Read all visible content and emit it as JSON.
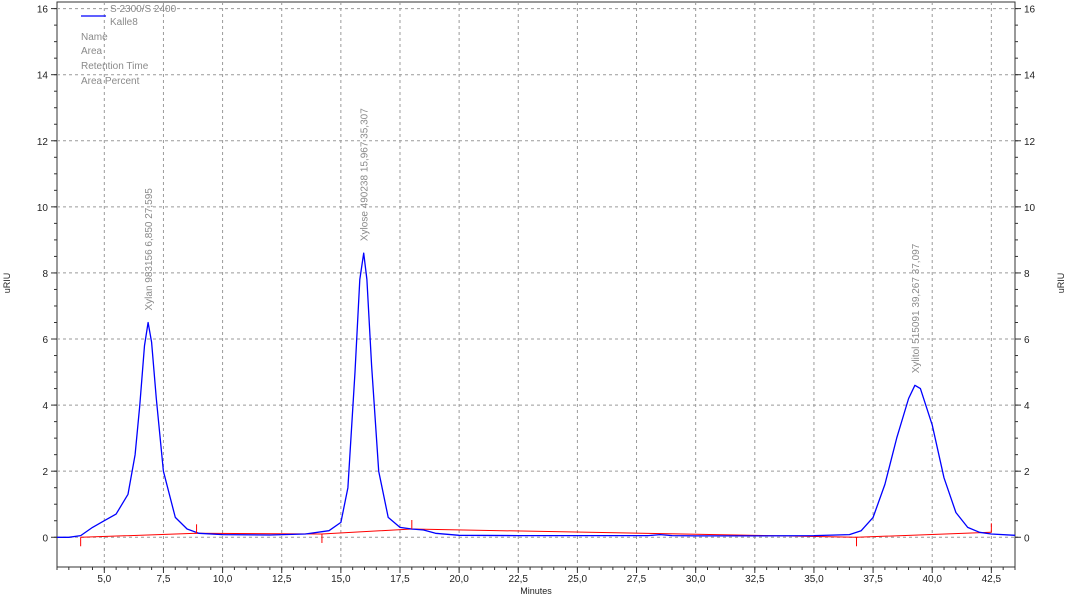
{
  "chart_data": {
    "type": "line",
    "xlabel": "Minutes",
    "ylabel_left": "uRIU",
    "ylabel_right": "uRIU",
    "xlim": [
      3.0,
      43.5
    ],
    "ylim": [
      -0.9,
      16.2
    ],
    "x_ticks": [
      5.0,
      7.5,
      10.0,
      12.5,
      15.0,
      17.5,
      20.0,
      22.5,
      25.0,
      27.5,
      30.0,
      32.5,
      35.0,
      37.5,
      40.0,
      42.5
    ],
    "x_tick_labels": [
      "5,0",
      "7,5",
      "10,0",
      "12,5",
      "15,0",
      "17,5",
      "20,0",
      "22,5",
      "25,0",
      "27,5",
      "30,0",
      "32,5",
      "35,0",
      "37,5",
      "40,0",
      "42,5"
    ],
    "y_ticks": [
      0,
      2,
      4,
      6,
      8,
      10,
      12,
      14,
      16
    ],
    "y_tick_labels": [
      "0",
      "2",
      "4",
      "6",
      "8",
      "10",
      "12",
      "14",
      "16"
    ],
    "grid": true,
    "legend": {
      "position": "top-left",
      "detector": "S 2300/S 2400",
      "series_name": "Kalle8",
      "fields": [
        "Name",
        "Area",
        "Retention Time",
        "Area Percent"
      ]
    },
    "series": [
      {
        "name": "Kalle8",
        "color": "#0000ff",
        "x": [
          3.0,
          3.5,
          4.0,
          4.5,
          5.0,
          5.5,
          6.0,
          6.3,
          6.5,
          6.7,
          6.85,
          7.0,
          7.2,
          7.5,
          8.0,
          8.5,
          9.0,
          10.0,
          12.0,
          13.5,
          14.5,
          15.0,
          15.3,
          15.6,
          15.8,
          15.967,
          16.1,
          16.3,
          16.6,
          17.0,
          17.5,
          18.0,
          18.5,
          19.0,
          20.0,
          22.5,
          25.0,
          28.0,
          28.5,
          29.0,
          30.0,
          32.5,
          35.0,
          36.5,
          37.0,
          37.5,
          38.0,
          38.5,
          39.0,
          39.267,
          39.5,
          40.0,
          40.5,
          41.0,
          41.5,
          42.0,
          42.5,
          43.5
        ],
        "y": [
          0.0,
          0.0,
          0.05,
          0.3,
          0.5,
          0.7,
          1.3,
          2.5,
          4.0,
          5.8,
          6.5,
          5.9,
          4.2,
          2.0,
          0.6,
          0.25,
          0.12,
          0.08,
          0.07,
          0.1,
          0.2,
          0.45,
          1.5,
          5.0,
          7.8,
          8.6,
          7.8,
          5.2,
          2.0,
          0.6,
          0.3,
          0.25,
          0.22,
          0.12,
          0.06,
          0.05,
          0.05,
          0.05,
          0.08,
          0.05,
          0.04,
          0.04,
          0.05,
          0.08,
          0.2,
          0.6,
          1.6,
          3.0,
          4.2,
          4.6,
          4.5,
          3.4,
          1.8,
          0.75,
          0.3,
          0.15,
          0.1,
          0.06
        ]
      },
      {
        "name": "Baseline",
        "color": "#ff0000",
        "x": [
          4.0,
          8.9,
          8.9,
          14.2,
          14.2,
          18.0,
          36.8,
          42.5
        ],
        "y": [
          0.0,
          0.12,
          0.12,
          0.1,
          0.1,
          0.25,
          0.0,
          0.15
        ]
      }
    ],
    "baseline_markers": [
      4.0,
      8.9,
      14.2,
      18.0,
      36.8,
      42.5
    ],
    "peaks": [
      {
        "name": "Xylan",
        "area": "983156",
        "retention_time": "6,850",
        "area_percent": "27,595",
        "x": 6.85,
        "y": 6.5
      },
      {
        "name": "Xylose",
        "area": "490238",
        "retention_time": "15,967",
        "area_percent": "35,307",
        "x": 15.967,
        "y": 8.6
      },
      {
        "name": "Xylitol",
        "area": "515091",
        "retention_time": "39,267",
        "area_percent": "37,097",
        "x": 39.267,
        "y": 4.6
      }
    ]
  }
}
